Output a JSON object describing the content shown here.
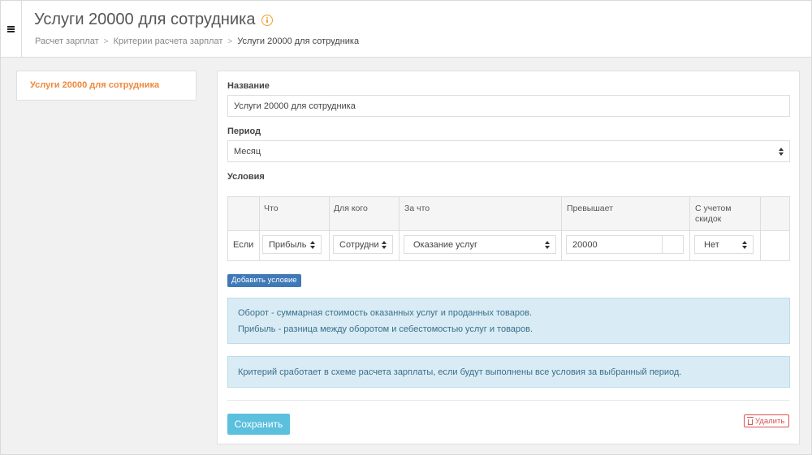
{
  "header": {
    "title": "Услуги 20000 для сотрудника",
    "breadcrumbs": [
      "Расчет зарплат",
      "Критерии расчета зарплат",
      "Услуги 20000 для сотрудника"
    ],
    "breadcrumb_separator": ">"
  },
  "sidebar": {
    "items": [
      {
        "label": "Услуги 20000 для сотрудника",
        "active": true
      }
    ]
  },
  "form": {
    "name_label": "Название",
    "name_value": "Услуги 20000 для сотрудника",
    "period_label": "Период",
    "period_value": "Месяц",
    "conditions_label": "Условия"
  },
  "conditions_table": {
    "columns": [
      "Что",
      "Для кого",
      "За что",
      "Превышает",
      "С учетом скидок"
    ],
    "column_what": "Что",
    "column_for_whom": "Для кого",
    "column_for_what": "За что",
    "column_exceeds": "Превышает",
    "column_discounts_line1": "С учетом",
    "column_discounts_line2": "скидок",
    "rows": [
      {
        "prefix": "Если",
        "what": "Прибыль",
        "for_whom": "Сотрудник",
        "for_what": "Оказание услуг",
        "exceeds": "20000",
        "exceeds_extra": "",
        "discounts": "Нет"
      }
    ]
  },
  "add_condition_label": "Добавить условие",
  "info": {
    "line1": "Оборот - суммарная стоимость оказанных услуг и проданных товаров.",
    "line2": "Прибыль - разница между оборотом и себестомостью услуг и товаров.",
    "criterion_note": "Критерий сработает в схеме расчета зарплаты, если будут выполнены все условия за выбранный период."
  },
  "actions": {
    "save_label": "Сохранить",
    "delete_label": "Удалить"
  },
  "colors": {
    "accent_orange": "#f0883a",
    "primary_blue": "#3f79b8",
    "save_cyan": "#5bc0de",
    "danger_red": "#d9534f",
    "info_bg": "#d9ecf5"
  }
}
